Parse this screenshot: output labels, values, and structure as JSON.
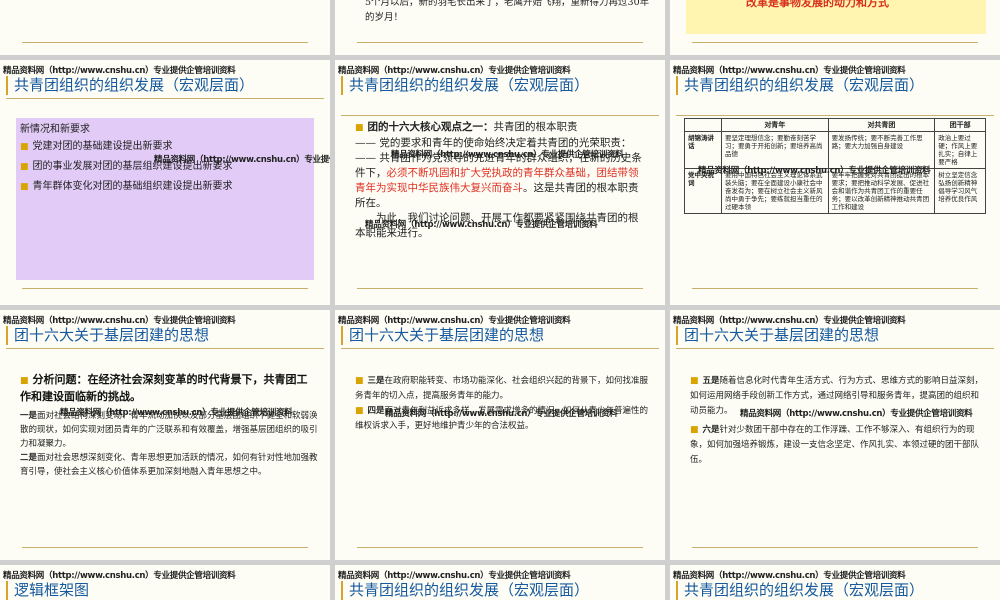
{
  "watermark": "精品资料网（http://www.cnshu.cn）专业提供企管培训资料",
  "slides": {
    "s1": {},
    "s2": {
      "text": "5个月以后，新的羽毛长出来了，老鹰开始飞翔，重新得力再过30年的岁月！"
    },
    "s3": {
      "text": "改革是事物发展的动力和方式"
    },
    "s4": {
      "title": "共青团组织的组织发展（宏观层面）",
      "box_heading": "新情况和新要求",
      "items": [
        "党建对团的基础建设提出新要求",
        "团的事业发展对团的基层组织建设提出新要求",
        "青年群体变化对团的基础组织建设提出新要求"
      ]
    },
    "s5": {
      "title": "共青团组织的组织发展（宏观层面）",
      "point_label": "团的十六大核心观点之一：",
      "point_rest": "共青团的根本职责",
      "line1": "—— 党的要求和青年的使命始终决定着共青团的光荣职责：",
      "line2": "—— 共青团作为党领导的先进青年的群众组织，在新的历史条件下，",
      "line2_red": "必须不断巩固和扩大党执政的青年群众基础，团结带领青年为实现中华民族伟大复兴而奋斗",
      "line2_end": "。这是共青团的根本职责所在。",
      "line3": "为此，我们讨论问题、开展工作都要紧紧围绕共青团的根本职能来进行。"
    },
    "s6": {
      "title": "共青团组织的组织发展（宏观层面）",
      "table": {
        "headers": [
          "",
          "对青年",
          "对共青团",
          "团干部"
        ],
        "rows": [
          [
            "胡锦涛讲话",
            "要坚定理想信念；要勤奋刻苦学习；要勇于开拓创新；要培养高尚品德",
            "要发扬传统；要不断完善工作思路；要大力加强自身建设",
            "政治上要过硬；作风上要扎实；自律上要严格"
          ],
          [
            "党中央祝词",
            "要用中国特色社会主义理论体系武装头脑；要在全面建设小康社会中奋发有为；要在树立社会主义新风尚中勇于争先；要练就担当重任的过硬本领",
            "要牢牢把握党对共青团提出的根本要求；要把推动科学发展、促进社会和谐作为共青团工作的重要任务；要以改革创新精神推动共青团工作和建设",
            "树立坚定信念弘扬创新精神倡导学习风气培养优良作风"
          ]
        ]
      }
    },
    "s7": {
      "title": "团十六大关于基层团建的思想",
      "head": "分析问题：在经济社会深刻变革的时代背景下，共青团工作和建设面临新的挑战。",
      "p1_label": "一是",
      "p1": "面对社会结构深刻变动、青年流动加快以及部分基层团组织不健全和软弱涣散的现状，如何实现对团员青年的广泛联系和有效覆盖，增强基层团组织的吸引力和凝聚力。",
      "p2_label": "二是",
      "p2": "面对社会思想深刻变化、青年思想更加活跃的情况，如何有针对性地加强教育引导，使社会主义核心价值体系更加深刻地融入青年思想之中。"
    },
    "s8": {
      "title": "团十六大关于基层团建的思想",
      "p3_label": "三是",
      "p3": "在政府职能转变、市场功能深化、社会组织兴起的背景下，如何找准服务青年的切入点，提高服务青年的能力。",
      "p4_label": "四是",
      "p4": "面对青年利益诉求多样、发展需求增多的情况，如何从青少年普遍性的维权诉求入手，更好地维护青少年的合法权益。"
    },
    "s9": {
      "title": "团十六大关于基层团建的思想",
      "p5_label": "五是",
      "p5": "随着信息化时代青年生活方式、行为方式、思维方式的影响日益深刻，如何运用网络手段创新工作方式，通过网络引导和服务青年，提高团的组织和动员能力。",
      "p6_label": "六是",
      "p6": "针对少数团干部中存在的工作浮躁、工作不够深入、有组织行为的现象，如何加强培养锻炼，建设一支信念坚定、作风扎实、本领过硬的团干部队伍。"
    },
    "s10": {
      "title": "逻辑框架图"
    },
    "s11": {
      "title": "共青团组织的组织发展（宏观层面）"
    },
    "s12": {
      "title": "共青团组织的组织发展（宏观层面）"
    }
  }
}
